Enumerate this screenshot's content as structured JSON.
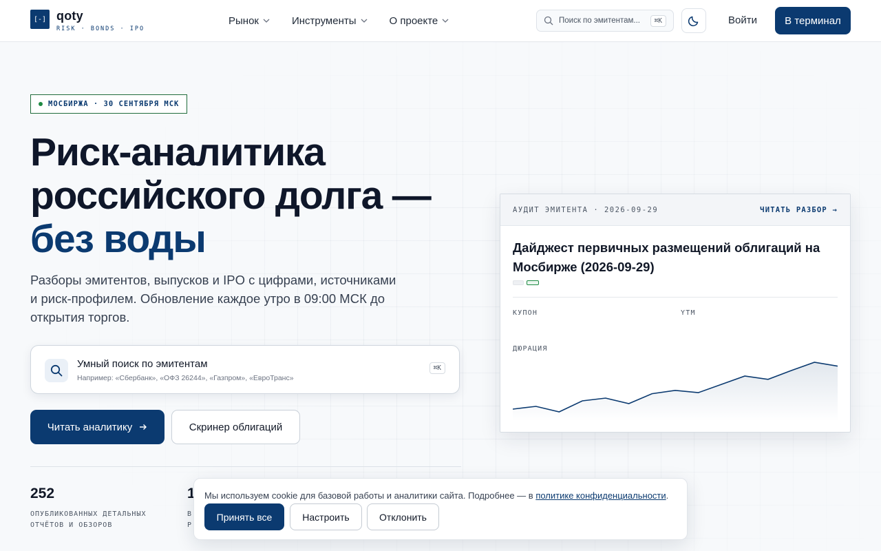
{
  "brand": {
    "mark": "[-]",
    "name": "qoty",
    "tagline": "RISK · BONDS · IPO"
  },
  "nav": {
    "items": [
      {
        "label": "Рынок"
      },
      {
        "label": "Инструменты"
      },
      {
        "label": "О проекте"
      }
    ],
    "search_placeholder": "Поиск по эмитентам...",
    "search_shortcut": "⌘K",
    "login_label": "Войти",
    "terminal_label": "В терминал"
  },
  "hero": {
    "badge": "МОСБИРЖА · 30 СЕНТЯБРЯ МСК",
    "title_line1": "Риск-аналитика",
    "title_line2": "российского долга —",
    "title_accent": "без воды",
    "subtitle": "Разборы эмитентов, выпусков и IPO с цифрами, источниками и риск-профилем. Обновление каждое утро в 09:00 МСК до открытия торгов.",
    "smart_search": {
      "title": "Умный поиск по эмитентам",
      "hint": "Например: «Сбербанк», «ОФЗ 26244», «Газпром», «ЕвроТранс»",
      "shortcut": "⌘K"
    },
    "primary_cta": "Читать аналитику",
    "secondary_cta": "Скринер облигаций"
  },
  "stats": [
    {
      "value": "252",
      "label_line1": "ОПУБЛИКОВАННЫХ ДЕТАЛЬНЫХ",
      "label_line2": "ОТЧЁТОВ И ОБЗОРОВ"
    },
    {
      "value": "1",
      "label_line1": "В",
      "label_line2": "Р"
    }
  ],
  "card": {
    "kicker": "АУДИТ ЭМИТЕНТА · 2026-09-29",
    "link": "ЧИТАТЬ РАЗБОР →",
    "title": "Дайджест первичных размещений облигаций на Мосбирже (2026-09-29)",
    "metrics": {
      "coupon": "КУПОН",
      "ytm": "YTM",
      "duration": "ДЮРАЦИЯ"
    },
    "sparkline": [
      0.1,
      0.15,
      0.05,
      0.25,
      0.3,
      0.2,
      0.38,
      0.44,
      0.4,
      0.55,
      0.7,
      0.64,
      0.8,
      0.95,
      0.88
    ],
    "accent": "#0b3a70"
  },
  "cookie": {
    "text": "Мы используем cookie для базовой работы и аналитики сайта. Подробнее — в ",
    "link": "политике конфиденциальности",
    "suffix": ".",
    "accept": "Принять все",
    "configure": "Настроить",
    "decline": "Отклонить"
  },
  "colors": {
    "brand": "#0b3a70",
    "live_dot": "#1f8a43"
  },
  "icons": {
    "search": "search-icon",
    "theme": "moon-icon",
    "chevron": "chevron-down-icon",
    "arrow": "arrow-right-icon"
  }
}
